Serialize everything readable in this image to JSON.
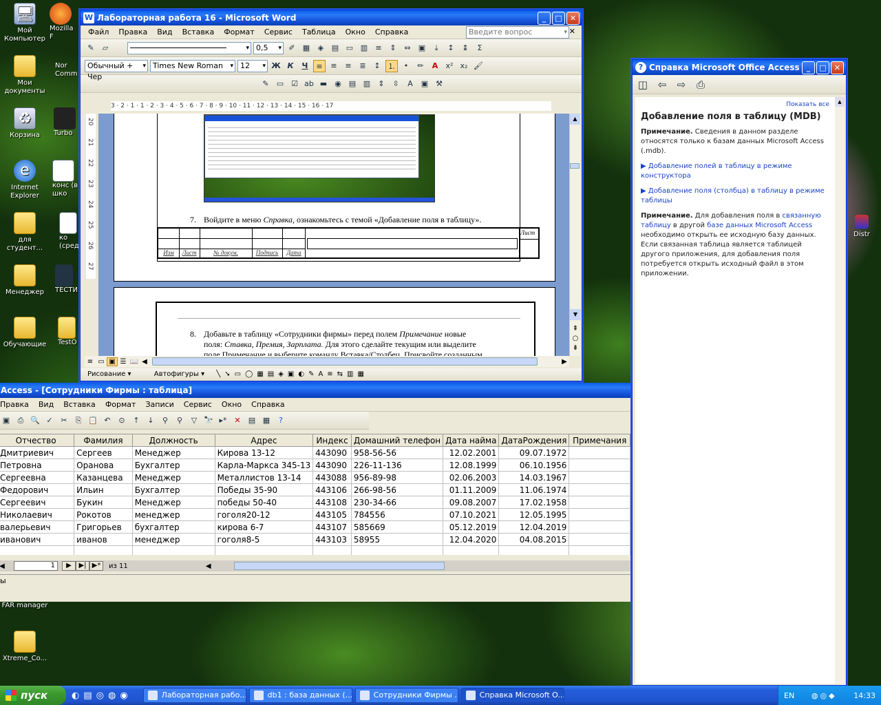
{
  "desktop_icons": [
    {
      "label": "Мой Компьютер",
      "icon": "computer-icon"
    },
    {
      "label": "Mozilla F",
      "icon": "firefox-icon"
    },
    {
      "label": "Мои документы",
      "icon": "my-documents-icon"
    },
    {
      "label": "Nor Comm",
      "icon": "norton-commander-icon"
    },
    {
      "label": "Корзина",
      "icon": "recycle-bin-icon"
    },
    {
      "label": "Turbo",
      "icon": "turbo-icon"
    },
    {
      "label": "Internet Explorer",
      "icon": "ie-icon"
    },
    {
      "label": "конс (в шко",
      "icon": "shortcut-icon"
    },
    {
      "label": "для студент...",
      "icon": "folder-icon"
    },
    {
      "label": "ко (сред",
      "icon": "shortcut-icon"
    },
    {
      "label": "Менеджер",
      "icon": "folder-icon"
    },
    {
      "label": "ТЕСТИ",
      "icon": "test-icon"
    },
    {
      "label": "Обучающие",
      "icon": "folder-icon"
    },
    {
      "label": "TestO",
      "icon": "folder-icon"
    },
    {
      "label": "FAR manager",
      "icon": "far-icon"
    },
    {
      "label": "Xtreme_Co...",
      "icon": "folder-icon"
    },
    {
      "label": "Distr",
      "icon": "distr-icon"
    }
  ],
  "word": {
    "title": "Лабораторная работа 16 - Microsoft Word",
    "menu": [
      "Файл",
      "Правка",
      "Вид",
      "Вставка",
      "Формат",
      "Сервис",
      "Таблица",
      "Окно",
      "Справка"
    ],
    "ask_placeholder": "Введите вопрос",
    "line_width": "0,5",
    "style": "Обычный + Чер",
    "font": "Times New Roman",
    "size": "12",
    "ruler": "3 · 2 · 1 · 1 · 2 · 3 · 4 · 5 · 6 · 7 · 8 · 9 · 10 · 11 · 12 · 13 · 14 · 15 · 16 · 17",
    "vruler": [
      "20",
      "21",
      "22",
      "23",
      "24",
      "25",
      "26",
      "27"
    ],
    "step7_num": "7.",
    "step7_pre": "Войдите в меню ",
    "step7_em": "Справка,",
    "step7_post": " ознакомьтесь с темой «Добавление поля в таблицу».",
    "stamp": [
      "Изм",
      "Лист",
      "№ докум.",
      "Подпись",
      "Дата"
    ],
    "sheet_label": "Лист",
    "step8_num": "8.",
    "step8_line1_pre": "Добавьте в таблицу «Сотрудники фирмы» перед полем ",
    "step8_line1_em": "Примечание",
    "step8_line1_post": " новые",
    "step8_line2_pre": "поля: ",
    "step8_line2_em": "Ставка, Премия, Зарплата.",
    "step8_line2_post": " Для этого сделайте текущим или выделите",
    "step8_line3": "поле Примечание и выберите команду Вставка/Столбец. Присвойте созданным",
    "draw_label": "Рисование ▾",
    "autoshapes_label": "Автофигуры ▾"
  },
  "access": {
    "title": "Access - [Сотрудники Фирмы : таблица]",
    "menu": [
      "Правка",
      "Вид",
      "Вставка",
      "Формат",
      "Записи",
      "Сервис",
      "Окно",
      "Справка"
    ],
    "columns": [
      "Отчество",
      "Фамилия",
      "Должность",
      "Адрес",
      "Индекс",
      "Домашний телефон",
      "Дата найма",
      "ДатаРождения",
      "Примечания"
    ],
    "rows": [
      [
        "Дмитриевич",
        "Сергеев",
        "Менеджер",
        "Кирова 13-12",
        "443090",
        "958-56-56",
        "12.02.2001",
        "09.07.1972",
        ""
      ],
      [
        "Петровна",
        "Оранова",
        "Бухгалтер",
        "Карла-Маркса 345-13",
        "443090",
        "226-11-136",
        "12.08.1999",
        "06.10.1956",
        ""
      ],
      [
        "Сергеевна",
        "Казанцева",
        "Менеджер",
        "Металлистов 13-14",
        "443088",
        "956-89-98",
        "02.06.2003",
        "14.03.1967",
        ""
      ],
      [
        "Федорович",
        "Ильин",
        "Бухгалтер",
        "Победы 35-90",
        "443106",
        "266-98-56",
        "01.11.2009",
        "11.06.1974",
        ""
      ],
      [
        "Сергеевич",
        "Букин",
        "Менеджер",
        "победы 50-40",
        "443108",
        "230-34-66",
        "09.08.2007",
        "17.02.1958",
        ""
      ],
      [
        "Николаевич",
        "Рокотов",
        "менеджер",
        "гоголя20-12",
        "443105",
        "784556",
        "07.10.2021",
        "12.05.1995",
        ""
      ],
      [
        "валерьевич",
        "Григорьев",
        "бухгалтер",
        "кирова 6-7",
        "443107",
        "585669",
        "05.12.2019",
        "12.04.2019",
        ""
      ],
      [
        "иванович",
        "иванов",
        "менеджер",
        "гоголя8-5",
        "443103",
        "58955",
        "12.04.2020",
        "04.08.2015",
        ""
      ]
    ],
    "record_current": "1",
    "record_total": "из 11",
    "status_fragment": "ы"
  },
  "help": {
    "title": "Справка Microsoft Office Access",
    "show_all": "Показать все",
    "heading": "Добавление поля в таблицу (MDB)",
    "note1_label": "Примечание.",
    "note1_text": " Сведения в данном разделе относятся только к базам данных Microsoft Access (.mdb).",
    "link1": "Добавление полей в таблицу в режиме конструктора",
    "link2": "Добавление поля (столбца) в таблицу в режиме таблицы",
    "note2_label": "Примечание.",
    "note2_pre": " Для добавления поля в ",
    "note2_link1": "связанную таблицу",
    "note2_mid": " в другой ",
    "note2_link2": "базе данных Microsoft Access",
    "note2_post": " необходимо открыть ее исходную базу данных. Если связанная таблица является таблицей другого приложения, для добавления поля потребуется открыть исходный файл в этом приложении."
  },
  "taskbar": {
    "start": "пуск",
    "tasks": [
      "Лабораторная рабо...",
      "db1 : база данных (...",
      "Сотрудники Фирмы ...",
      "Справка Microsoft O..."
    ],
    "lang": "EN",
    "clock": "14:33"
  }
}
